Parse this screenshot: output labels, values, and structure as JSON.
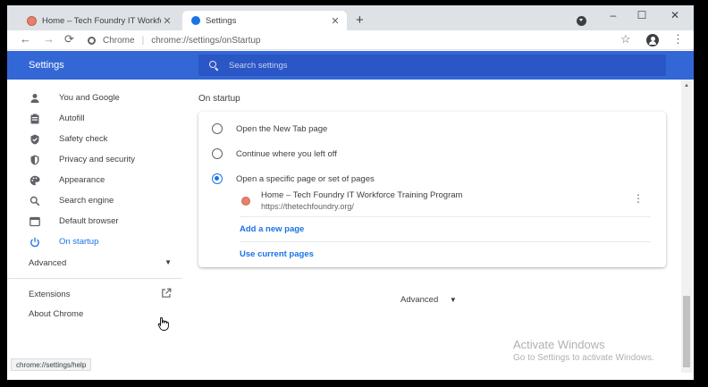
{
  "browser": {
    "tabs": [
      {
        "title": "Home – Tech Foundry IT Workfo",
        "close": "✕",
        "favicon": "tech-foundry-favicon"
      },
      {
        "title": "Settings",
        "close": "✕",
        "favicon": "gear-icon"
      }
    ],
    "new_tab": "+",
    "window": {
      "minimize": "–",
      "maximize": "☐",
      "close": "✕"
    },
    "omnibox": {
      "origin": "Chrome",
      "separator": "|",
      "url": "chrome://settings/onStartup"
    },
    "nav": {
      "back": "←",
      "forward": "→",
      "reload": "⟳"
    },
    "star": "☆",
    "menu": "⋮",
    "status_url": "chrome://settings/help"
  },
  "settings": {
    "title": "Settings",
    "search": {
      "placeholder": "Search settings"
    }
  },
  "sidebar": {
    "items": [
      {
        "label": "You and Google",
        "icon": "person-icon"
      },
      {
        "label": "Autofill",
        "icon": "clipboard-icon"
      },
      {
        "label": "Safety check",
        "icon": "shield-icon"
      },
      {
        "label": "Privacy and security",
        "icon": "shield-lock-icon"
      },
      {
        "label": "Appearance",
        "icon": "palette-icon"
      },
      {
        "label": "Search engine",
        "icon": "search-icon"
      },
      {
        "label": "Default browser",
        "icon": "browser-icon"
      },
      {
        "label": "On startup",
        "icon": "power-icon"
      }
    ],
    "advanced": "Advanced",
    "extensions": "Extensions",
    "about": "About Chrome"
  },
  "main": {
    "section": "On startup",
    "options": [
      {
        "label": "Open the New Tab page",
        "selected": false
      },
      {
        "label": "Continue where you left off",
        "selected": false
      },
      {
        "label": "Open a specific page or set of pages",
        "selected": true
      }
    ],
    "page": {
      "title": "Home – Tech Foundry IT Workforce Training Program",
      "url": "https://thetechfoundry.org/"
    },
    "add_page": "Add a new page",
    "use_current": "Use current pages",
    "advanced": "Advanced"
  },
  "watermark": {
    "line1": "Activate Windows",
    "line2": "Go to Settings to activate Windows."
  },
  "colors": {
    "header": "#3367d6",
    "accent": "#1a73e8"
  }
}
